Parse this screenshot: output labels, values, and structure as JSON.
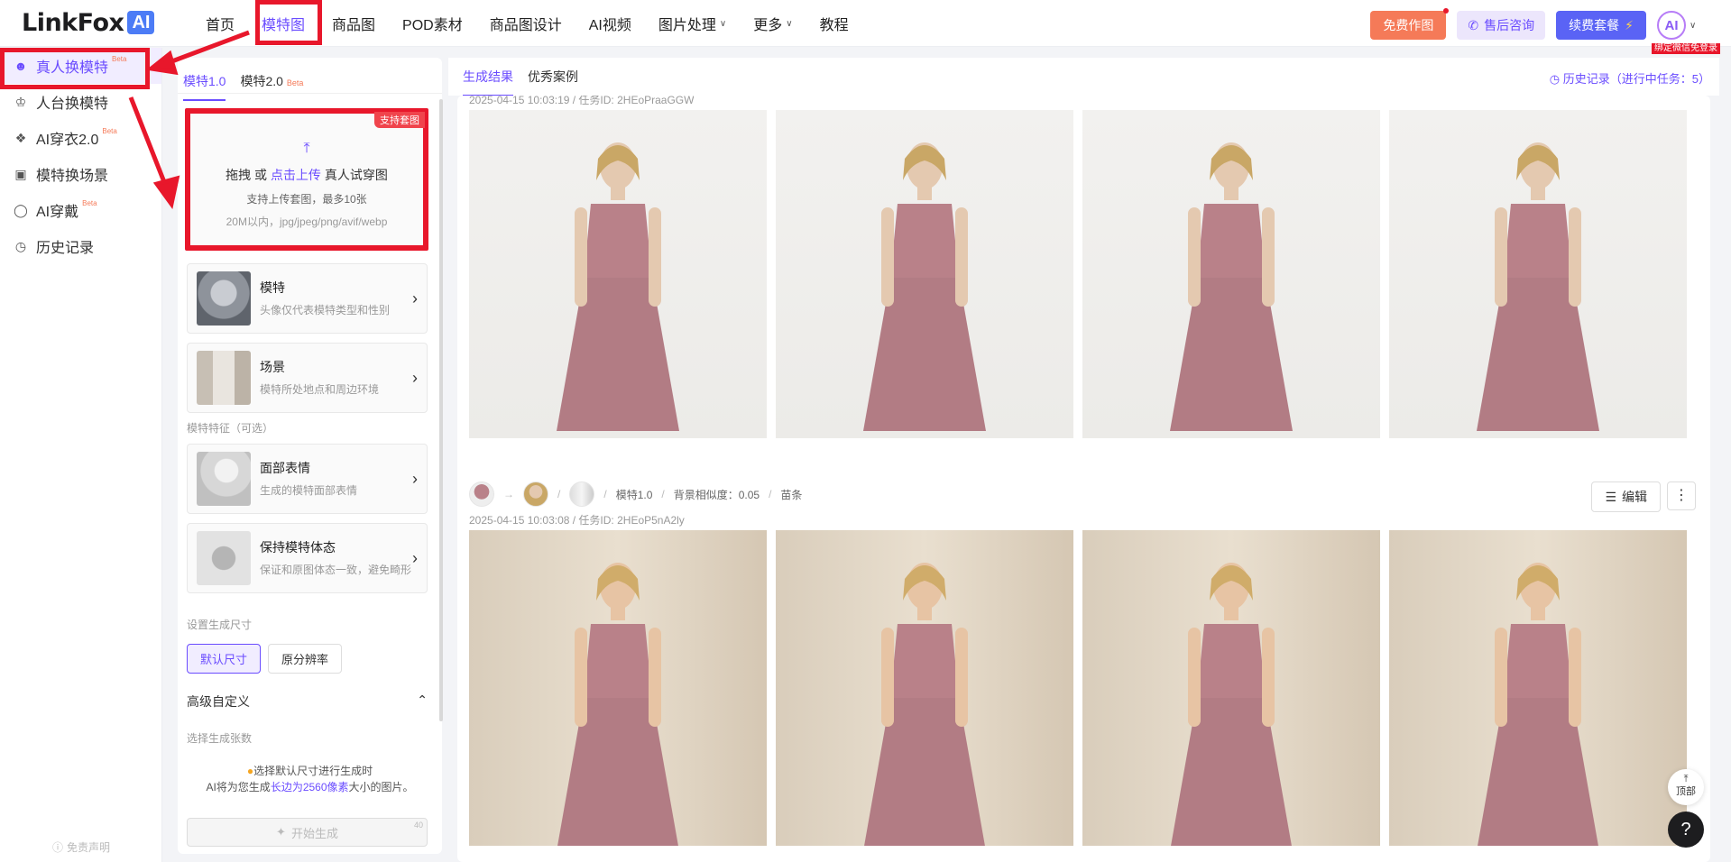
{
  "logo": {
    "text": "LinkFox",
    "badge": "AI"
  },
  "nav": [
    {
      "label": "首页",
      "active": false,
      "dropdown": false
    },
    {
      "label": "模特图",
      "active": true,
      "dropdown": false
    },
    {
      "label": "商品图",
      "active": false,
      "dropdown": false
    },
    {
      "label": "POD素材",
      "active": false,
      "dropdown": false
    },
    {
      "label": "商品图设计",
      "active": false,
      "dropdown": false
    },
    {
      "label": "AI视频",
      "active": false,
      "dropdown": false
    },
    {
      "label": "图片处理",
      "active": false,
      "dropdown": true
    },
    {
      "label": "更多",
      "active": false,
      "dropdown": true
    },
    {
      "label": "教程",
      "active": false,
      "dropdown": false
    }
  ],
  "topright": {
    "free_label": "免费作图",
    "service_label": "售后咨询",
    "renew_label": "续费套餐",
    "avatar_text": "AI",
    "avatar_tag": "绑定微信免登录"
  },
  "sidebar": {
    "items": [
      {
        "label": "真人换模特",
        "beta": "Beta",
        "active": true,
        "icon": "model-swap-icon"
      },
      {
        "label": "人台换模特",
        "beta": "",
        "active": false,
        "icon": "mannequin-icon"
      },
      {
        "label": "AI穿衣2.0",
        "beta": "Beta",
        "active": false,
        "icon": "shirt-icon"
      },
      {
        "label": "模特换场景",
        "beta": "",
        "active": false,
        "icon": "scene-icon"
      },
      {
        "label": "AI穿戴",
        "beta": "Beta",
        "active": false,
        "icon": "wear-icon"
      },
      {
        "label": "历史记录",
        "beta": "",
        "active": false,
        "icon": "history-icon"
      }
    ],
    "disclaimer": "免责声明"
  },
  "panel": {
    "tabs": [
      {
        "label": "模特1.0",
        "beta": ""
      },
      {
        "label": "模特2.0",
        "beta": "Beta"
      }
    ],
    "upload": {
      "corner": "支持套图",
      "line1_pre": "拖拽 或 ",
      "line1_link": "点击上传",
      "line1_post": " 真人试穿图",
      "line2": "支持上传套图，最多10张",
      "line3": "20M以内，jpg/jpeg/png/avif/webp"
    },
    "model_card": {
      "title": "模特",
      "desc": "头像仅代表模特类型和性别"
    },
    "scene_card": {
      "title": "场景",
      "desc": "模特所处地点和周边环境"
    },
    "features_label": "模特特征（可选）",
    "face_card": {
      "title": "面部表情",
      "desc": "生成的模特面部表情"
    },
    "pose_card": {
      "title": "保持模特体态",
      "desc": "保证和原图体态一致，避免畸形"
    },
    "size_label": "设置生成尺寸",
    "size_default": "默认尺寸",
    "size_original": "原分辨率",
    "advanced_label": "高级自定义",
    "count_label": "选择生成张数",
    "tip_line1": "选择默认尺寸进行生成时",
    "tip_line2_pre": "AI将为您生成",
    "tip_line2_hl": "长边为2560像素",
    "tip_line2_post": "大小的图片。",
    "generate_label": "开始生成",
    "generate_cost": "40"
  },
  "main": {
    "tabs": [
      {
        "label": "生成结果",
        "active": true
      },
      {
        "label": "优秀案例",
        "active": false
      }
    ],
    "history": "历史记录（进行中任务：5）",
    "result1": {
      "meta": "2025-04-15 10:03:19 / 任务ID: 2HEoPraaGGW"
    },
    "result2": {
      "model": "模特1.0",
      "similarity": "背景相似度：0.05",
      "style": "苗条",
      "meta": "2025-04-15 10:03:08 / 任务ID: 2HEoP5nA2ly",
      "edit_label": "编辑"
    },
    "to_top": "顶部",
    "help": "?"
  },
  "colors": {
    "accent": "#6a4cff",
    "highlight": "#e8172b",
    "dress": "#b98189"
  }
}
